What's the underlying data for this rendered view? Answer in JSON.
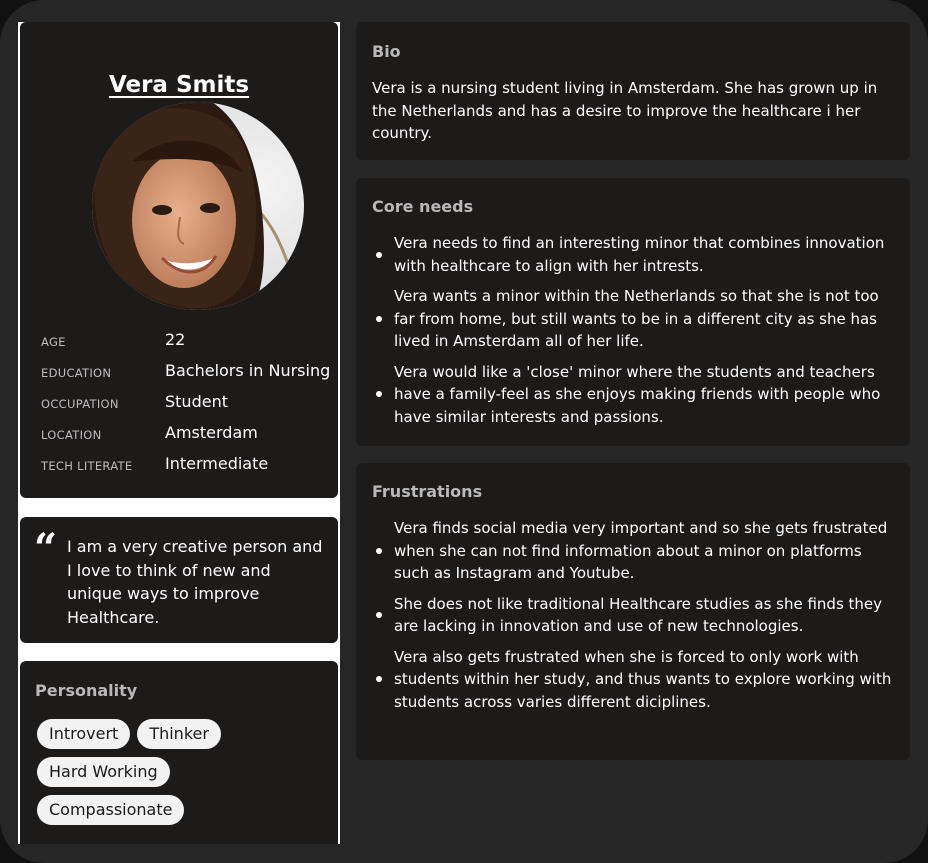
{
  "profile": {
    "name": "Vera Smits",
    "facts": [
      {
        "key": "AGE",
        "value": "22"
      },
      {
        "key": "EDUCATION",
        "value": "Bachelors in Nursing"
      },
      {
        "key": "OCCUPATION",
        "value": "Student"
      },
      {
        "key": "LOCATION",
        "value": "Amsterdam"
      },
      {
        "key": "TECH LITERATE",
        "value": "Intermediate"
      }
    ]
  },
  "quote": {
    "mark": "“",
    "text": "I am a very creative person and I love to think of new and unique ways to improve Healthcare."
  },
  "personality": {
    "title": "Personality",
    "tags": [
      "Introvert",
      "Thinker",
      "Hard Working",
      "Compassionate"
    ]
  },
  "bio": {
    "title": "Bio",
    "text": "Vera is a nursing student living in Amsterdam. She has grown up in the Netherlands and has a desire to improve the healthcare i her country."
  },
  "core_needs": {
    "title": "Core needs",
    "items": [
      "Vera needs to find an interesting minor that combines innovation with healthcare to align with her intrests.",
      "Vera wants a minor within the Netherlands so that she is not too far from home, but still wants to be in a different city as she has lived in Amsterdam all of her life.",
      "Vera would like a 'close' minor where the students and teachers have a family-feel as she enjoys making friends with people who have similar interests and passions."
    ]
  },
  "frustrations": {
    "title": "Frustrations",
    "items": [
      "Vera finds social media very important and so she gets frustrated when she can not find information about a minor on platforms such as Instagram and Youtube.",
      "She does not like traditional Healthcare studies as she finds they are lacking in innovation and use of new technologies.",
      "Vera also gets frustrated when she is forced to only work with students within her study, and thus wants to explore working with students across varies different diciplines."
    ]
  },
  "colors": {
    "background": "#262626",
    "panel": "#1d1a1a",
    "tag": "#f2f2f2"
  }
}
